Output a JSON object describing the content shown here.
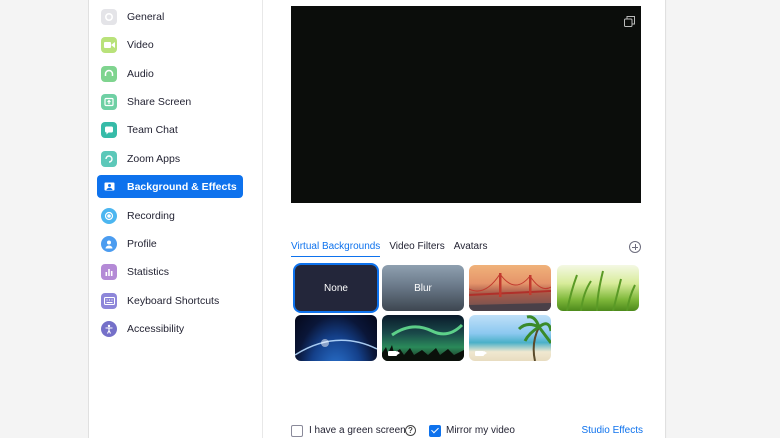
{
  "sidebar": {
    "items": [
      {
        "label": "General",
        "icon": "gear-icon",
        "color": "#e4e4e8",
        "active": false
      },
      {
        "label": "Video",
        "icon": "video-camera-icon",
        "color": "#b9e27a",
        "active": false
      },
      {
        "label": "Audio",
        "icon": "headphones-icon",
        "color": "#7fd48f",
        "active": false
      },
      {
        "label": "Share Screen",
        "icon": "share-screen-icon",
        "color": "#6fd0a4",
        "active": false
      },
      {
        "label": "Team Chat",
        "icon": "chat-icon",
        "color": "#36bba8",
        "active": false
      },
      {
        "label": "Zoom Apps",
        "icon": "apps-icon",
        "color": "#5cc8b9",
        "active": false
      },
      {
        "label": "Background & Effects",
        "icon": "background-icon",
        "color": "#0e72ed",
        "active": true
      },
      {
        "label": "Recording",
        "icon": "record-icon",
        "color": "#4cb6f0",
        "active": false
      },
      {
        "label": "Profile",
        "icon": "profile-icon",
        "color": "#4b9cf0",
        "active": false
      },
      {
        "label": "Statistics",
        "icon": "statistics-icon",
        "color": "#b48ad6",
        "active": false
      },
      {
        "label": "Keyboard Shortcuts",
        "icon": "keyboard-icon",
        "color": "#8d86d9",
        "active": false
      },
      {
        "label": "Accessibility",
        "icon": "accessibility-icon",
        "color": "#7570c9",
        "active": false
      }
    ]
  },
  "preview": {
    "icon": "popout-icon"
  },
  "tabs": [
    {
      "label": "Virtual Backgrounds",
      "active": true
    },
    {
      "label": "Video Filters",
      "active": false
    },
    {
      "label": "Avatars",
      "active": false
    }
  ],
  "add_icon": "add-icon",
  "backgrounds": [
    {
      "label": "None",
      "kind": "none",
      "selected": true
    },
    {
      "label": "Blur",
      "kind": "blur",
      "selected": false
    },
    {
      "label": "",
      "kind": "golden-gate",
      "selected": false
    },
    {
      "label": "",
      "kind": "grass",
      "selected": false
    },
    {
      "label": "",
      "kind": "earth",
      "selected": false
    },
    {
      "label": "",
      "kind": "aurora",
      "selected": false,
      "video": true
    },
    {
      "label": "",
      "kind": "beach",
      "selected": false,
      "video": true
    }
  ],
  "footer": {
    "green_screen_label": "I have a green screen",
    "green_screen_checked": false,
    "help_icon": "help-icon",
    "mirror_label": "Mirror my video",
    "mirror_checked": true,
    "studio_effects_label": "Studio Effects"
  },
  "colors": {
    "accent": "#0e72ed"
  }
}
